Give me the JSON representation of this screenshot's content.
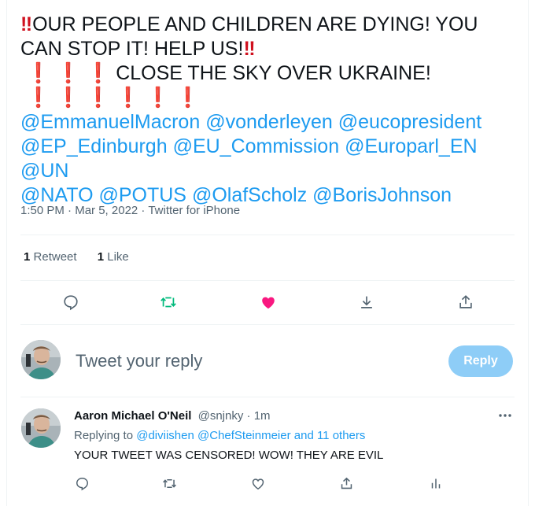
{
  "tweet": {
    "line1_text": "OUR PEOPLE AND CHILDREN ARE DYING! YOU CAN STOP IT! HELP US!",
    "line2_text": "CLOSE THE SKY OVER UKRAINE!",
    "mentions": [
      "@EmmanuelMacron",
      "@vonderleyen",
      "@eucopresident",
      "@EP_Edinburgh",
      "@EU_Commission",
      "@Europarl_EN",
      "@UN",
      "@NATO",
      "@POTUS",
      "@OlafScholz",
      "@BorisJohnson"
    ],
    "time": "1:50 PM",
    "date": "Mar 5, 2022",
    "source": "Twitter for iPhone",
    "retweet_count": "1",
    "retweet_label": "Retweet",
    "like_count": "1",
    "like_label": "Like",
    "colors": {
      "accent": "#1d9bf0",
      "retweet": "#00ba7c",
      "like": "#f91880",
      "emphasis": "#d0111f"
    }
  },
  "composer": {
    "placeholder": "Tweet your reply",
    "reply_button": "Reply"
  },
  "reply": {
    "name": "Aaron Michael O'Neil",
    "handle": "@snjnky",
    "time": "1m",
    "replying_prefix": "Replying to",
    "replying_to": "@diviishen @ChefSteinmeier and 11 others",
    "text": "YOUR TWEET WAS CENSORED! WOW! THEY ARE EVIL"
  }
}
